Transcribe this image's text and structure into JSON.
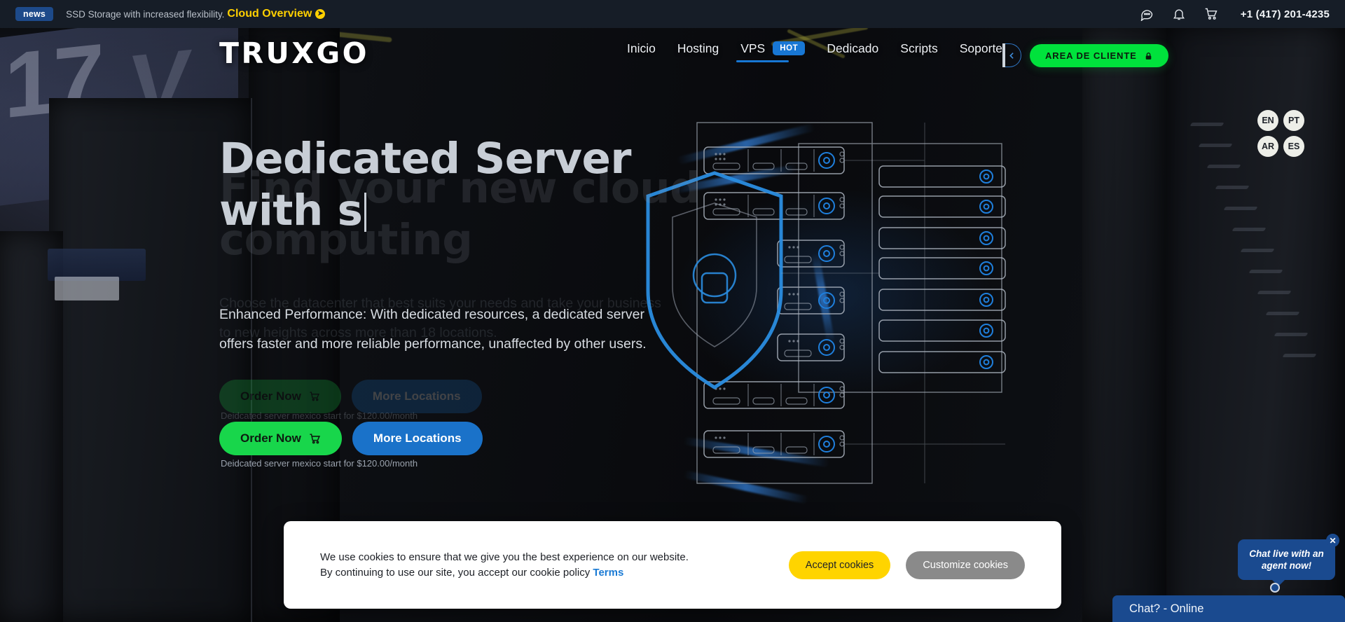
{
  "announcement": {
    "badge": "news",
    "text": "SSD Storage with increased flexibility.",
    "link": "Cloud Overview",
    "arrow": "❯",
    "icons": [
      "chat-icon",
      "bell-icon",
      "cart-icon"
    ],
    "phone": "+1 (417) 201-4235"
  },
  "nav": {
    "logo": "TRUXGO",
    "links": [
      {
        "label": "Inicio",
        "active": false
      },
      {
        "label": "Hosting",
        "active": false
      },
      {
        "label": "VPS",
        "active": true,
        "badge": "HOT"
      },
      {
        "label": "Dedicado",
        "active": false
      },
      {
        "label": "Scripts",
        "active": false
      },
      {
        "label": "Soporte",
        "active": false
      }
    ],
    "client_button": "AREA DE CLIENTE",
    "client_button_icon": "lock-icon",
    "collapse_icon": "chevron-left-icon"
  },
  "languages": [
    "EN",
    "PT",
    "AR",
    "ES"
  ],
  "hero": {
    "headline_ghost": "Find your new cloud computing",
    "headline_live": "Dedicated Server with s",
    "sub_ghost": "Choose the datacenter that best suits your needs and take your business to new heights across more than 18 locations.",
    "sub_live": "Enhanced Performance: With dedicated resources, a dedicated server offers faster and more reliable performance, unaffected by other users.",
    "btn_order": "Order Now",
    "btn_order_icon": "cart-icon",
    "btn_more": "More Locations",
    "price_note": "Deidcated server mexico start for $120.00/month"
  },
  "cookie": {
    "line1": "We use cookies to ensure that we give you the best experience on our website.",
    "line2": "By continuing to use our site, you accept our cookie policy",
    "terms": "Terms",
    "accept": "Accept cookies",
    "customize": "Customize cookies"
  },
  "chat": {
    "bubble": "Chat live with an agent now!",
    "close_icon": "close-icon",
    "bar": "Chat? - Online"
  },
  "colors": {
    "accent_blue": "#1777d4",
    "accent_green": "#00e23c",
    "accent_yellow": "#ffd000",
    "bar_dark": "#161d27"
  }
}
